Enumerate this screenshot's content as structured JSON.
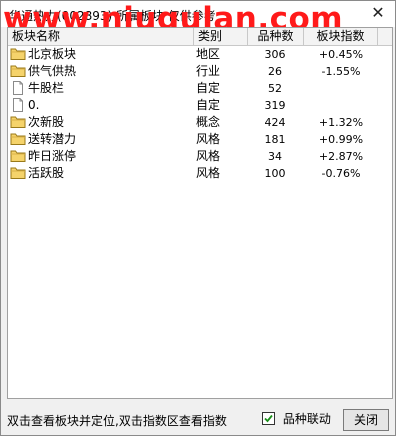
{
  "window": {
    "title": "华通热力(002893)   所属板块 仅供参考",
    "watermark": "www.niugulan.com",
    "close_label": "✕"
  },
  "table": {
    "columns": [
      "板块名称",
      "类别",
      "品种数",
      "板块指数"
    ],
    "rows": [
      {
        "icon": "folder-icon",
        "name": "北京板块",
        "category": "地区",
        "count": "306",
        "index": "+0.45%"
      },
      {
        "icon": "folder-icon",
        "name": "供气供热",
        "category": "行业",
        "count": "26",
        "index": "-1.55%"
      },
      {
        "icon": "document-icon",
        "name": "牛股栏",
        "category": "自定",
        "count": "52",
        "index": ""
      },
      {
        "icon": "document-icon",
        "name": "0.",
        "category": "自定",
        "count": "319",
        "index": ""
      },
      {
        "icon": "folder-icon",
        "name": "次新股",
        "category": "概念",
        "count": "424",
        "index": "+1.32%"
      },
      {
        "icon": "folder-icon",
        "name": "送转潜力",
        "category": "风格",
        "count": "181",
        "index": "+0.99%"
      },
      {
        "icon": "folder-icon",
        "name": "昨日涨停",
        "category": "风格",
        "count": "34",
        "index": "+2.87%"
      },
      {
        "icon": "folder-icon",
        "name": "活跃股",
        "category": "风格",
        "count": "100",
        "index": "-0.76%"
      }
    ]
  },
  "footer": {
    "hint": "双击查看板块并定位,双击指数区查看指数",
    "checkbox_label": "品种联动",
    "checkbox_checked": true,
    "close_button": "关闭"
  },
  "colors": {
    "watermark": "#ff1a1a",
    "folder": "#f5d36b",
    "checkmark": "#1a8f1a"
  }
}
